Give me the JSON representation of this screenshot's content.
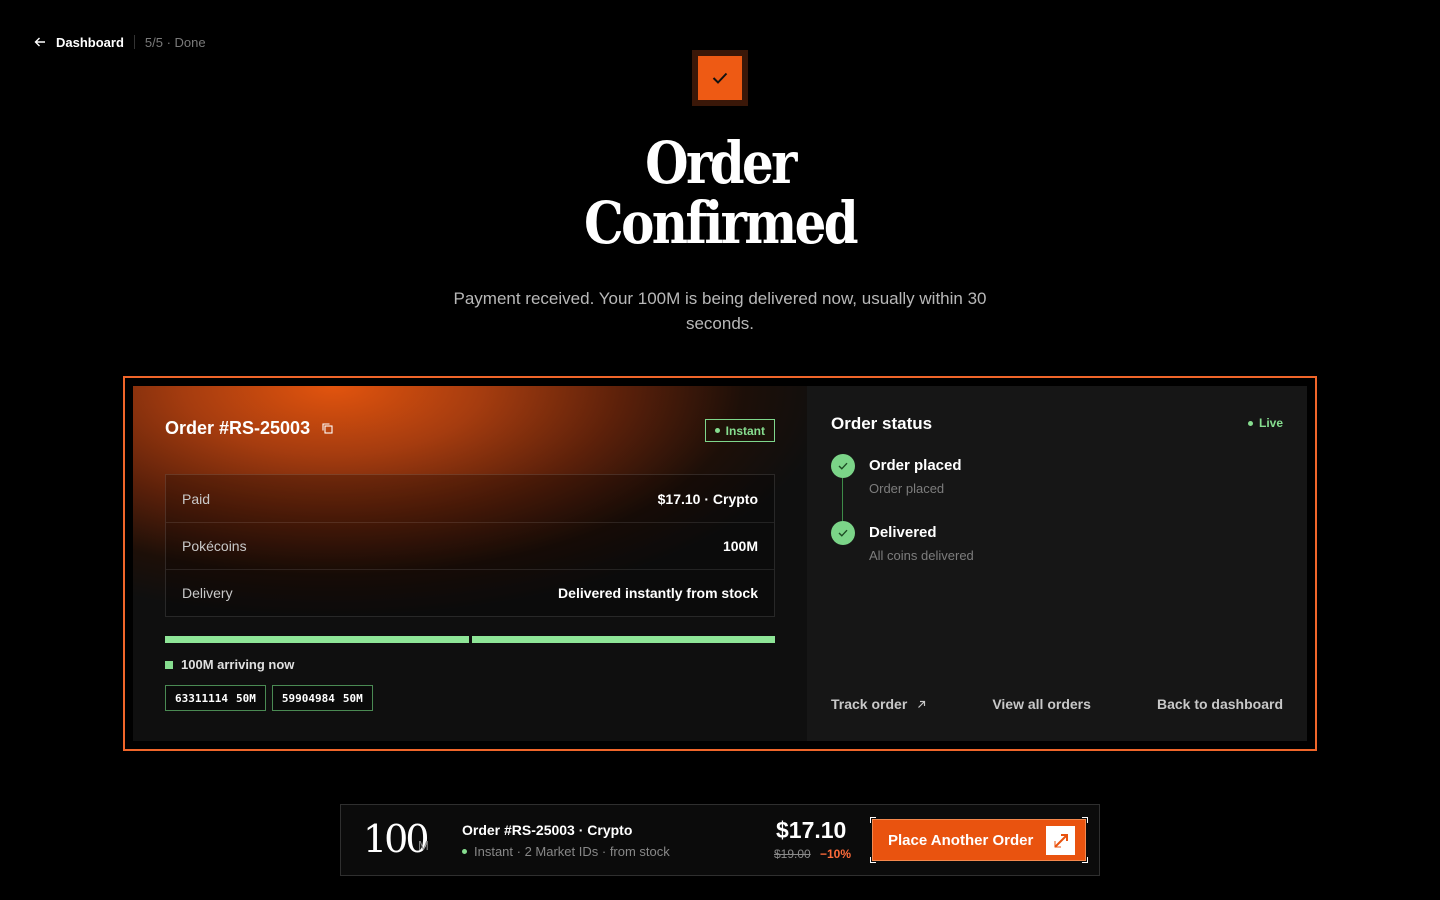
{
  "nav": {
    "back_label": "Dashboard",
    "step": "5/5 · Done"
  },
  "hero": {
    "title_line1": "Order",
    "title_line2": "Confirmed",
    "subtitle": "Payment received. Your 100M is being delivered now, usually within 30 seconds."
  },
  "order": {
    "id": "Order #RS-25003",
    "badge": "Instant",
    "rows": [
      {
        "key": "Paid",
        "value": "$17.10 · Crypto"
      },
      {
        "key": "Pokécoins",
        "value": "100M"
      },
      {
        "key": "Delivery",
        "value": "Delivered instantly from stock"
      }
    ],
    "progress": [
      1.0,
      1.0
    ],
    "arriving": "100M arriving now",
    "market_ids": [
      {
        "id": "63311114",
        "amount": "50M"
      },
      {
        "id": "59904984",
        "amount": "50M"
      }
    ]
  },
  "status": {
    "title": "Order status",
    "live": "Live",
    "steps": [
      {
        "title": "Order placed",
        "sub": "Order placed"
      },
      {
        "title": "Delivered",
        "sub": "All coins delivered"
      }
    ],
    "actions": {
      "track": "Track order",
      "view_all": "View all orders",
      "back": "Back to dashboard"
    }
  },
  "bottom": {
    "amount": "100",
    "unit": "M",
    "order": "Order #RS-25003 · Crypto",
    "meta": "Instant · 2 Market IDs · from stock",
    "price": "$17.10",
    "old_price": "$19.00",
    "discount": "−10%",
    "cta": "Place Another Order"
  },
  "colors": {
    "accent": "#ee5a14",
    "success": "#86dd8f",
    "frame": "#f0662a"
  },
  "icons": {
    "back": "arrow-left-icon",
    "check": "check-icon",
    "copy": "copy-icon",
    "external": "arrow-up-right-icon",
    "cta": "pickaxe-icon"
  }
}
